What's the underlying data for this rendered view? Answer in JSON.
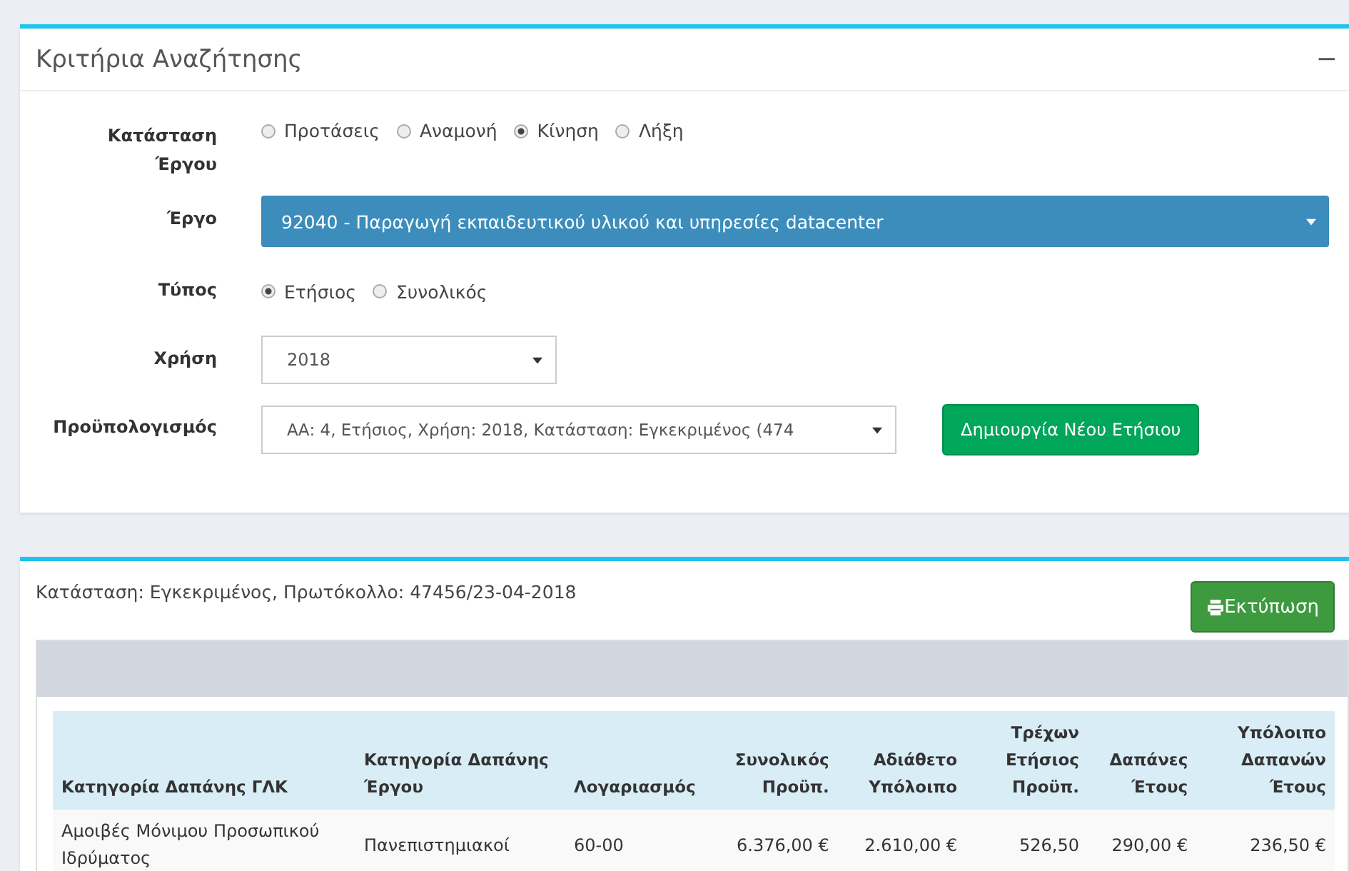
{
  "search_panel": {
    "title": "Κριτήρια Αναζήτησης",
    "collapse": "−",
    "fields": [
      {
        "kind": "radios",
        "label": "Κατάσταση Έργου",
        "options": [
          {
            "label": "Προτάσεις",
            "selected": false
          },
          {
            "label": "Αναμονή",
            "selected": false
          },
          {
            "label": "Κίνηση",
            "selected": true
          },
          {
            "label": "Λήξη",
            "selected": false
          }
        ]
      },
      {
        "kind": "primary-select",
        "label": "Έργο",
        "value": "92040 - Παραγωγή εκπαιδευτικού υλικού και υπηρεσίες datacenter"
      },
      {
        "kind": "radios",
        "label": "Τύπος",
        "options": [
          {
            "label": "Ετήσιος",
            "selected": true
          },
          {
            "label": "Συνολικός",
            "selected": false
          }
        ]
      },
      {
        "kind": "select",
        "label": "Χρήση",
        "value": "2018"
      },
      {
        "kind": "select-button",
        "label": "Προϋπολογισμός",
        "value": "ΑΑ: 4, Ετήσιος, Χρήση: 2018, Κατάσταση: Εγκεκριμένος (474",
        "button": "Δημιουργία Νέου Ετήσιου"
      }
    ]
  },
  "budget_panel": {
    "status": "Κατάσταση: Εγκεκριμένος, Πρωτόκολλο: 47456/23-04-2018",
    "print_button": "Εκτύπωση",
    "table": {
      "columns": [
        "Κατηγορία Δαπάνης ΓΛΚ",
        "Κατηγορία Δαπάνης Έργου",
        "Λογαριασμός",
        "Συνολικός Προϋπ.",
        "Αδιάθετο Υπόλοιπο",
        "Τρέχων Ετήσιος Προϋπ.",
        "Δαπάνες Έτους",
        "Υπόλοιπο Δαπανών Έτους"
      ],
      "rows": [
        [
          "Αμοιβές Μόνιμου Προσωπικού Ιδρύματος",
          "Πανεπιστημιακοί",
          "60-00",
          "6.376,00 €",
          "2.610,00 €",
          "526,50",
          "290,00 €",
          "236,50 €"
        ]
      ]
    }
  }
}
